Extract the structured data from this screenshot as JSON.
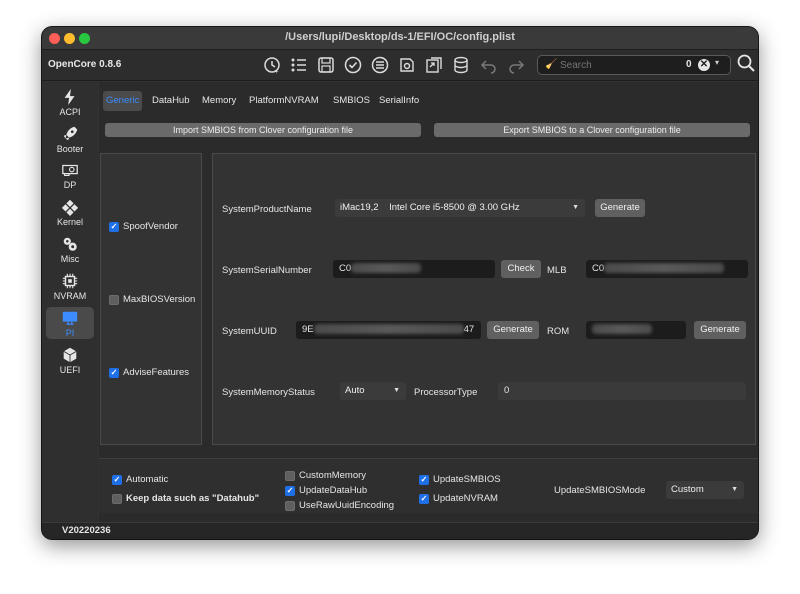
{
  "window": {
    "title": "/Users/lupi/Desktop/ds-1/EFI/OC/config.plist"
  },
  "toolbar": {
    "app_name": "OpenCore 0.8.6",
    "icons": [
      "recent-files-icon",
      "list-icon",
      "save-icon",
      "check-circle-icon",
      "list-circle-icon",
      "settings-icon",
      "open-file-icon",
      "database-icon",
      "undo-icon",
      "redo-icon"
    ],
    "search_placeholder": "Search",
    "search_count": "0"
  },
  "sidebar": {
    "items": [
      {
        "label": "ACPI",
        "icon": "bolt-icon"
      },
      {
        "label": "Booter",
        "icon": "rocket-icon"
      },
      {
        "label": "DP",
        "icon": "gpu-card-icon"
      },
      {
        "label": "Kernel",
        "icon": "kernel-icon"
      },
      {
        "label": "Misc",
        "icon": "gears-icon"
      },
      {
        "label": "NVRAM",
        "icon": "chip-icon"
      },
      {
        "label": "PI",
        "icon": "monitor-icon",
        "active": true
      },
      {
        "label": "UEFI",
        "icon": "cube-icon"
      }
    ]
  },
  "tabs": [
    "Generic",
    "DataHub",
    "Memory",
    "PlatformNVRAM",
    "SMBIOS",
    "SerialInfo"
  ],
  "actions": {
    "import": "Import SMBIOS from Clover configuration file",
    "export": "Export SMBIOS to a Clover configuration file"
  },
  "left_checks": [
    {
      "label": "SpoofVendor",
      "checked": true
    },
    {
      "label": "MaxBIOSVersion",
      "checked": false
    },
    {
      "label": "AdviseFeatures",
      "checked": true
    }
  ],
  "fields": {
    "product_name_label": "SystemProductName",
    "product_name_value": "iMac19,2    Intel Core i5-8500 @ 3.00 GHz",
    "serial_label": "SystemSerialNumber",
    "serial_value": "C0",
    "check_button": "Check",
    "mlb_label": "MLB",
    "mlb_value": "C0",
    "uuid_label": "SystemUUID",
    "uuid_prefix": "9E",
    "uuid_suffix": "47",
    "rom_label": "ROM",
    "memory_status_label": "SystemMemoryStatus",
    "memory_status_value": "Auto",
    "processor_type_label": "ProcessorType",
    "processor_type_value": "0",
    "generate_label": "Generate"
  },
  "bottom": {
    "automatic": {
      "label": "Automatic",
      "checked": true
    },
    "keep_data": {
      "label": "Keep data such as \"Datahub\"",
      "checked": false
    },
    "custom_memory": {
      "label": "CustomMemory",
      "checked": false
    },
    "update_datahub": {
      "label": "UpdateDataHub",
      "checked": true
    },
    "use_raw_uuid": {
      "label": "UseRawUuidEncoding",
      "checked": false
    },
    "update_smbios": {
      "label": "UpdateSMBIOS",
      "checked": true
    },
    "update_nvram": {
      "label": "UpdateNVRAM",
      "checked": true
    },
    "mode_label": "UpdateSMBIOSMode",
    "mode_value": "Custom"
  },
  "status": {
    "version": "V20220236"
  },
  "colors": {
    "accent": "#3c8cff",
    "checkbox": "#1f6fe8",
    "window_bg": "#323232"
  }
}
